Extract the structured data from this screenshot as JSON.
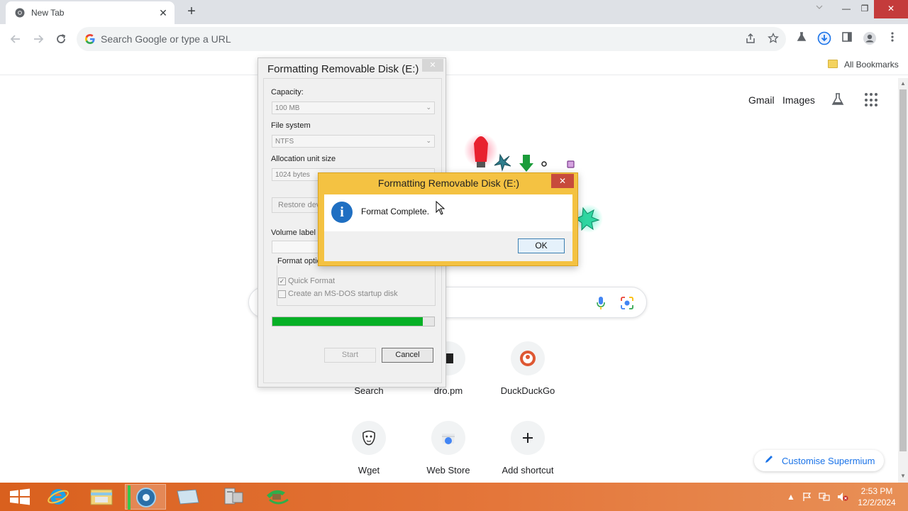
{
  "browser": {
    "tab": {
      "title": "New Tab",
      "close": "✕"
    },
    "newtab": "+",
    "window": {
      "min": "—",
      "max": "❐",
      "close": "✕"
    },
    "omnibox": {
      "placeholder": "Search Google or type a URL"
    },
    "bookmarks": {
      "all_bookmarks": "All Bookmarks"
    }
  },
  "ntp": {
    "links": {
      "gmail": "Gmail",
      "images": "Images"
    },
    "shortcuts": [
      {
        "name": "Search"
      },
      {
        "name": "dro.pm"
      },
      {
        "name": "DuckDuckGo"
      },
      {
        "name": "Wget"
      },
      {
        "name": "Web Store"
      },
      {
        "name": "Add shortcut"
      }
    ],
    "customise": "Customise Supermium"
  },
  "format_dialog": {
    "title": "Formatting Removable Disk (E:)",
    "close": "✕",
    "capacity_label": "Capacity:",
    "capacity_value": "100 MB",
    "filesystem_label": "File system",
    "filesystem_value": "NTFS",
    "allocation_label": "Allocation unit size",
    "allocation_value": "1024 bytes",
    "restore_button": "Restore dev",
    "volume_label": "Volume label",
    "format_options_label": "Format options",
    "quick_format": {
      "label": "Quick Format",
      "checked": true
    },
    "msdos": {
      "label": "Create an MS-DOS startup disk",
      "checked": false
    },
    "progress_fraction": 0.93,
    "start_button": "Start",
    "cancel_button": "Cancel"
  },
  "message_box": {
    "title": "Formatting Removable Disk (E:)",
    "close": "✕",
    "message": "Format Complete.",
    "ok_button": "OK"
  },
  "taskbar": {
    "time": "2:53 PM",
    "date": "12/2/2024"
  },
  "colors": {
    "taskbar": "#d9601e",
    "message_frame": "#f4c242",
    "progress": "#06b025",
    "accent_blue": "#1a73e8"
  }
}
